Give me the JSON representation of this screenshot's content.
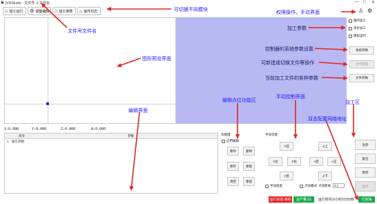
{
  "window": {
    "title": "[VDStudio - 文件号: 0  文件名:",
    "min": "—",
    "max": "□",
    "close": "✕"
  },
  "toolbar": [
    {
      "label": "加工运行",
      "icon": "home-icon"
    },
    {
      "label": "调整编辑",
      "icon": "gear-icon"
    },
    {
      "label": "加工参数",
      "icon": "home-icon"
    },
    {
      "label": "操作日志",
      "icon": "home-icon"
    }
  ],
  "side_options": [
    "循环加工",
    "单步加工",
    "模拟运行"
  ],
  "side_buttons": [
    {
      "label": "系统参数",
      "disabled": false
    },
    {
      "label": "文件管理",
      "disabled": true
    },
    {
      "label": "文件参数",
      "disabled": false
    }
  ],
  "coords": [
    "X:0.000",
    "Y:0.000",
    "Z:0.000",
    "A:0.000"
  ],
  "edit_table": {
    "col1": "指令",
    "col2": "参数",
    "rows": [
      {
        "no": "1",
        "cmd": "加工开始"
      }
    ]
  },
  "point_func": {
    "title": "功能键",
    "checkbox": "启用编辑",
    "buttons": [
      "教导",
      "复制",
      "保存",
      "保留",
      "清空",
      "保留"
    ]
  },
  "manual": {
    "title": "手动功能",
    "buttons": {
      "y_plus": "Y前",
      "z_up": "Z上",
      "x_minus": "X左",
      "x_plus": "X右",
      "a_minus": "A后",
      "a_plus": "A正",
      "y_minus": "Y后",
      "z_down": "Z下"
    },
    "mode_manual": "手动速度",
    "mode_point": "点动模式",
    "distance_label": "点动距离",
    "distance_value": "0.1"
  },
  "right_buttons": [
    {
      "label": "急停",
      "disabled": false
    },
    {
      "label": "复位",
      "disabled": false
    },
    {
      "label": "暂停",
      "disabled": false
    },
    {
      "label": "运行",
      "disabled": true
    }
  ],
  "status": {
    "run_state": "运行状态:待机",
    "output": "总产量:15",
    "runtime": "运行时间:0小时0分55秒",
    "connection": "已连接",
    "colors": {
      "run_state": "#e0241f",
      "output": "#1aa84b",
      "connection": "#1aa84b"
    }
  },
  "annotations": {
    "modules": "可切换不同模块",
    "file": "文件号文件名",
    "permission": "权限操作，手动界面",
    "process_params": "加工参数",
    "system_params": "控制器的系统参数设置",
    "file_ops": "可新建或切换文件等操作",
    "file_params": "当前加工文件的各种参数",
    "preview": "图形预览界面",
    "edit": "编辑界面",
    "point_func": "编辑点位功能区",
    "manual": "手动控制界面",
    "network": "双击配置网络地址",
    "process_area": "加工区"
  },
  "accent": "#1a1aff"
}
